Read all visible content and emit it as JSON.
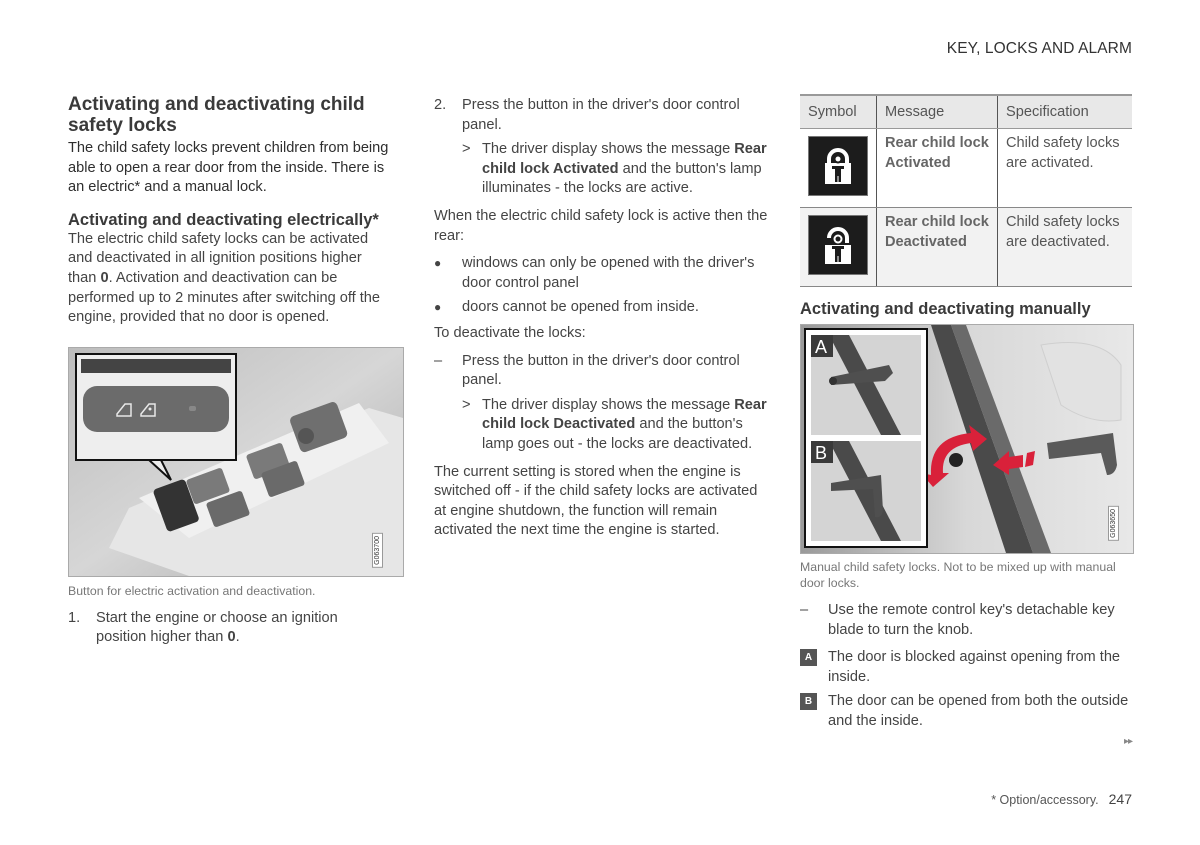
{
  "header": {
    "section_title": "KEY, LOCKS AND ALARM"
  },
  "column1": {
    "heading": "Activating and deactivating child safety locks",
    "intro": "The child safety locks prevent children from being able to open a rear door from the inside. There is an electric* and a manual lock.",
    "subheading": "Activating and deactivating electrically*",
    "body_parts": [
      "The electric child safety locks can be activated and deactivated in all ignition positions higher than ",
      "0",
      ". Activation and deactivation can be performed up to 2 minutes after switching off the engine, provided that no door is opened."
    ],
    "figure": {
      "image_code": "G063700",
      "alt": "door-control-panel-photo"
    },
    "caption": "Button for electric activation and deactivation.",
    "step1": {
      "num": "1.",
      "text": "Start the engine or choose an ignition position higher than ",
      "bold": "0",
      "end": "."
    }
  },
  "column2": {
    "step2": {
      "num": "2.",
      "text": "Press the button in the driver's door control panel."
    },
    "result1": {
      "marker": ">",
      "pre": "The driver display shows the message ",
      "bold": "Rear child lock Activated",
      "post": " and the button's lamp illuminates - the locks are active."
    },
    "when_active": "When the electric child safety lock is active then the rear:",
    "bullets": [
      "windows can only be opened with the driver's door control panel",
      "doors cannot be opened from inside."
    ],
    "deactivate_intro": "To deactivate the locks:",
    "deactivate_step": {
      "marker": "–",
      "text": "Press the button in the driver's door control panel."
    },
    "result2": {
      "marker": ">",
      "pre": "The driver display shows the message ",
      "bold": "Rear child lock Deactivated",
      "post": " and the button's lamp goes out - the locks are deactivated."
    },
    "stored_note": "The current setting is stored when the engine is switched off - if the child safety locks are activated at engine shutdown, the function will remain activated the next time the engine is started."
  },
  "column3": {
    "table": {
      "headers": [
        "Symbol",
        "Message",
        "Specification"
      ],
      "rows": [
        {
          "symbol": "child-lock-activated-icon",
          "message": "Rear child lock Activated",
          "spec": "Child safety locks are activated."
        },
        {
          "symbol": "child-lock-deactivated-icon",
          "message": "Rear child lock Deactivated",
          "spec": "Child safety locks are deactivated."
        }
      ]
    },
    "subheading": "Activating and deactivating manually",
    "figure": {
      "image_code": "G063650",
      "inset_labels": [
        "A",
        "B"
      ],
      "arrow_color": "#d9213a"
    },
    "caption": "Manual child safety locks. Not to be mixed up with manual door locks.",
    "step": {
      "marker": "–",
      "text": "Use the remote control key's detachable key blade to turn the knob."
    },
    "legend": [
      {
        "label": "A",
        "text": "The door is blocked against opening from the inside."
      },
      {
        "label": "B",
        "text": "The door can be opened from both the outside and the inside."
      }
    ]
  },
  "footer": {
    "continue_marker": "▸▸",
    "footnote": "* Option/accessory.",
    "page_number": "247"
  }
}
